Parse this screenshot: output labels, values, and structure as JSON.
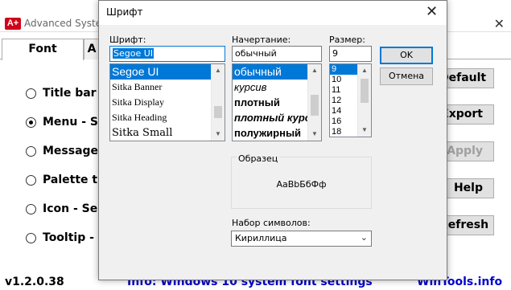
{
  "bg_app": {
    "icon_text": "A+",
    "title": "Advanced System Font Changer",
    "close_glyph": "✕",
    "tabs": [
      "Font",
      "A"
    ],
    "radio_items": [
      {
        "label": "Title bar -",
        "checked": false
      },
      {
        "label": "Menu - Se",
        "checked": true
      },
      {
        "label": "Message b",
        "checked": false
      },
      {
        "label": "Palette tit",
        "checked": false
      },
      {
        "label": "Icon - Seg",
        "checked": false
      },
      {
        "label": "Tooltip - S",
        "checked": false
      }
    ],
    "buttons": [
      "Default",
      "Export",
      "Apply",
      "Help",
      "Refresh"
    ],
    "status": {
      "version": "v1.2.0.38",
      "info": "Info: Windows 10 system font settings",
      "brand": "WinTools.info"
    },
    "colors": {
      "status_info": "#0000cc",
      "status_brand": "#0000cc",
      "icon_bg": "#d0021b"
    }
  },
  "dialog": {
    "title": "Шрифт",
    "close_glyph": "✕",
    "font": {
      "label": "Шрифт:",
      "value": "Segoe UI",
      "items": [
        "Segoe UI",
        "Sitka Banner",
        "Sitka Display",
        "Sitka Heading",
        "Sitka Small"
      ],
      "selected_index": 0
    },
    "style": {
      "label": "Начертание:",
      "value": "обычный",
      "items": [
        "обычный",
        "курсив",
        "плотный",
        "плотный курсив",
        "полужирный"
      ],
      "selected_index": 0
    },
    "size": {
      "label": "Размер:",
      "value": "9",
      "items": [
        "9",
        "10",
        "11",
        "12",
        "14",
        "16",
        "18"
      ],
      "selected_index": 0
    },
    "ok_label": "OK",
    "cancel_label": "Отмена",
    "sample": {
      "label": "Образец",
      "text": "AaBbБбФф"
    },
    "charset": {
      "label": "Набор символов:",
      "value": "Кириллица"
    },
    "colors": {
      "selection": "#0078d7"
    }
  }
}
